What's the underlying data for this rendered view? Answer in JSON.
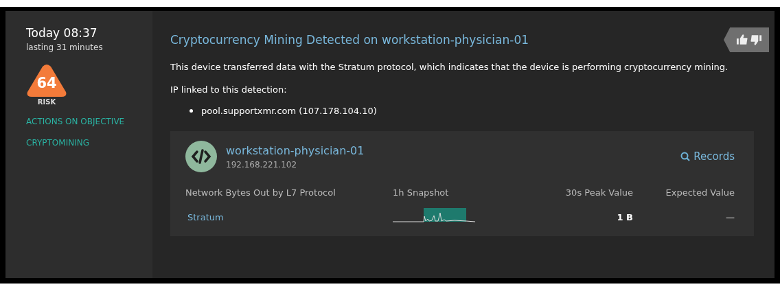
{
  "sidebar": {
    "time": "Today 08:37",
    "duration": "lasting 31 minutes",
    "risk": {
      "score": "64",
      "label": "RISK"
    },
    "tags": [
      "ACTIONS ON OBJECTIVE",
      "CRYPTOMINING"
    ]
  },
  "detection": {
    "title": "Cryptocurrency Mining Detected on workstation-physician-01",
    "description": "This device transferred data with the Stratum protocol, which indicates that the device is performing cryptocurrency mining.",
    "ip_heading": "IP linked to this detection:",
    "ips": [
      "pool.supportxmr.com (107.178.104.10)"
    ]
  },
  "device": {
    "name": "workstation-physician-01",
    "ip": "192.168.221.102",
    "records_link": "Records",
    "columns": [
      "Network Bytes Out by L7 Protocol",
      "1h Snapshot",
      "30s Peak Value",
      "Expected Value"
    ],
    "rows": [
      {
        "protocol": "Stratum",
        "peak": "1 B",
        "expected": "—"
      }
    ]
  }
}
